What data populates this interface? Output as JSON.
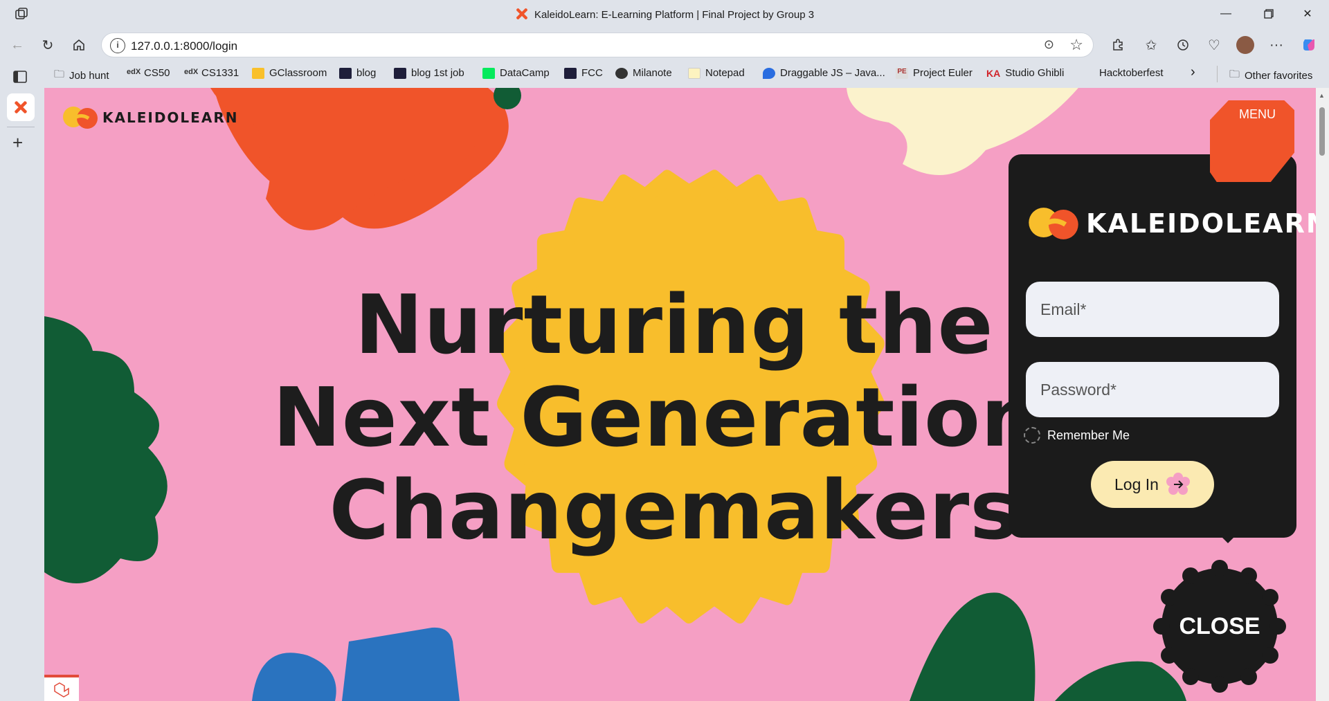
{
  "window": {
    "title": "KaleidoLearn: E-Learning Platform | Final Project by Group 3",
    "minimize_icon": "minimize-icon",
    "restore_icon": "restore-icon",
    "close_icon": "close-icon"
  },
  "address_bar": {
    "url": "127.0.0.1:8000/login"
  },
  "bookmarks": [
    {
      "label": "Job hunt",
      "icon": "folder-icon"
    },
    {
      "label": "CS50",
      "icon": "edx-icon"
    },
    {
      "label": "CS1331",
      "icon": "edx-icon"
    },
    {
      "label": "GClassroom",
      "icon": "classroom-icon"
    },
    {
      "label": "blog",
      "icon": "site-icon"
    },
    {
      "label": "blog 1st job",
      "icon": "site-icon"
    },
    {
      "label": "DataCamp",
      "icon": "datacamp-icon"
    },
    {
      "label": "FCC",
      "icon": "site-icon"
    },
    {
      "label": "Milanote",
      "icon": "milanote-icon"
    },
    {
      "label": "Notepad",
      "icon": "notepad-icon"
    },
    {
      "label": "Draggable JS – Java...",
      "icon": "drop-icon"
    },
    {
      "label": "Project Euler",
      "icon": "euler-icon"
    },
    {
      "label": "Studio Ghibli",
      "icon": "ka-icon"
    },
    {
      "label": "Hacktoberfest",
      "icon": ""
    },
    {
      "label": "Other favorites",
      "icon": "folder-icon"
    }
  ],
  "page": {
    "brand": "KALEIDOLEARN",
    "menu_label": "MENU",
    "hero_lines": [
      "Nurturing the",
      "Next Generation of",
      "Changemakers"
    ],
    "login_panel": {
      "brand": "KALEIDOLEARN",
      "email_placeholder": "Email*",
      "password_placeholder": "Password*",
      "remember_label": "Remember Me",
      "login_label": "Log In"
    },
    "close_label": "CLOSE"
  },
  "colors": {
    "background_pink": "#f59fc4",
    "orange": "#f0542a",
    "yellow": "#f8be2c",
    "green": "#115c35",
    "cream": "#fbf2cc",
    "blue": "#2a73bf",
    "dark": "#1b1b1b"
  }
}
